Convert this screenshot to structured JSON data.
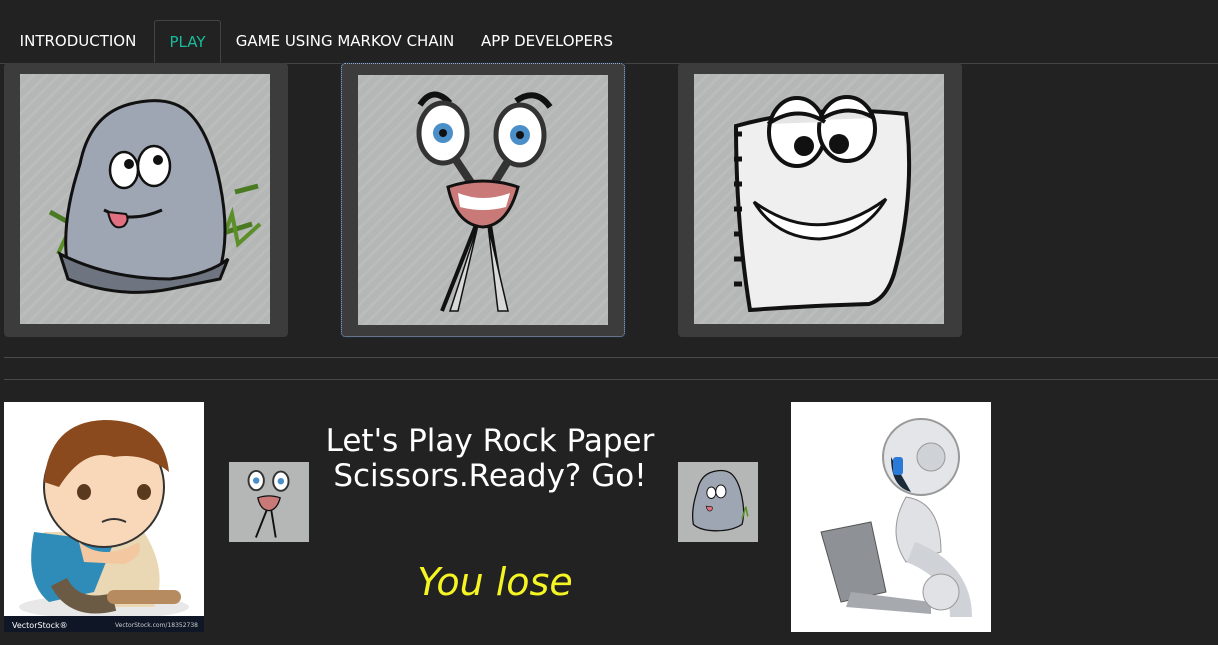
{
  "nav": {
    "tabs": [
      {
        "label": "INTRODUCTION",
        "active": false
      },
      {
        "label": "PLAY",
        "active": true
      },
      {
        "label": "GAME USING MARKOV CHAIN",
        "active": false
      },
      {
        "label": "APP DEVELOPERS",
        "active": false
      }
    ]
  },
  "choices": [
    {
      "name": "rock",
      "icon": "rock-character-icon"
    },
    {
      "name": "scissors",
      "icon": "scissors-character-icon"
    },
    {
      "name": "paper",
      "icon": "paper-character-icon"
    }
  ],
  "game": {
    "headline": "Let's Play Rock Paper Scissors.Ready? Go!",
    "result": "You lose",
    "player_choice": "scissors",
    "computer_choice": "rock",
    "result_color": "#f5f523"
  },
  "watermark": {
    "brand": "VectorStock®",
    "url": "VectorStock.com/18352738"
  },
  "colors": {
    "background": "#222222",
    "active_tab": "#18bc9c",
    "card_bg": "#3c3c3c"
  }
}
